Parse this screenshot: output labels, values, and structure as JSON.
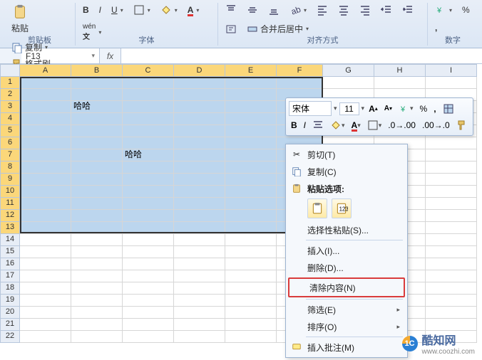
{
  "ribbon": {
    "paste_label": "粘贴",
    "copy_label": "复制",
    "format_painter_label": "格式刷",
    "clipboard_group": "剪贴板",
    "font_group": "字体",
    "align_group": "对齐方式",
    "number_group": "数字",
    "merge_label": "合并后居中",
    "percent": "%"
  },
  "namebox": {
    "value": "F13"
  },
  "fx": {
    "symbol": "fx"
  },
  "columns": [
    "A",
    "B",
    "C",
    "D",
    "E",
    "F",
    "G",
    "H",
    "I"
  ],
  "cells": {
    "B3": "哈哈",
    "C7": "哈哈"
  },
  "mini": {
    "font_name": "宋体",
    "font_size": "11",
    "percent": "%"
  },
  "ctx": {
    "cut": "剪切(T)",
    "copy": "复制(C)",
    "paste_options": "粘贴选项:",
    "paste_special": "选择性粘贴(S)...",
    "insert": "插入(I)...",
    "delete": "删除(D)...",
    "clear": "清除内容(N)",
    "filter": "筛选(E)",
    "sort": "排序(O)",
    "insert_comment": "插入批注(M)"
  },
  "watermark": {
    "brand": "酷知网",
    "url": "www.coozhi.com",
    "ico_text": "1C"
  }
}
